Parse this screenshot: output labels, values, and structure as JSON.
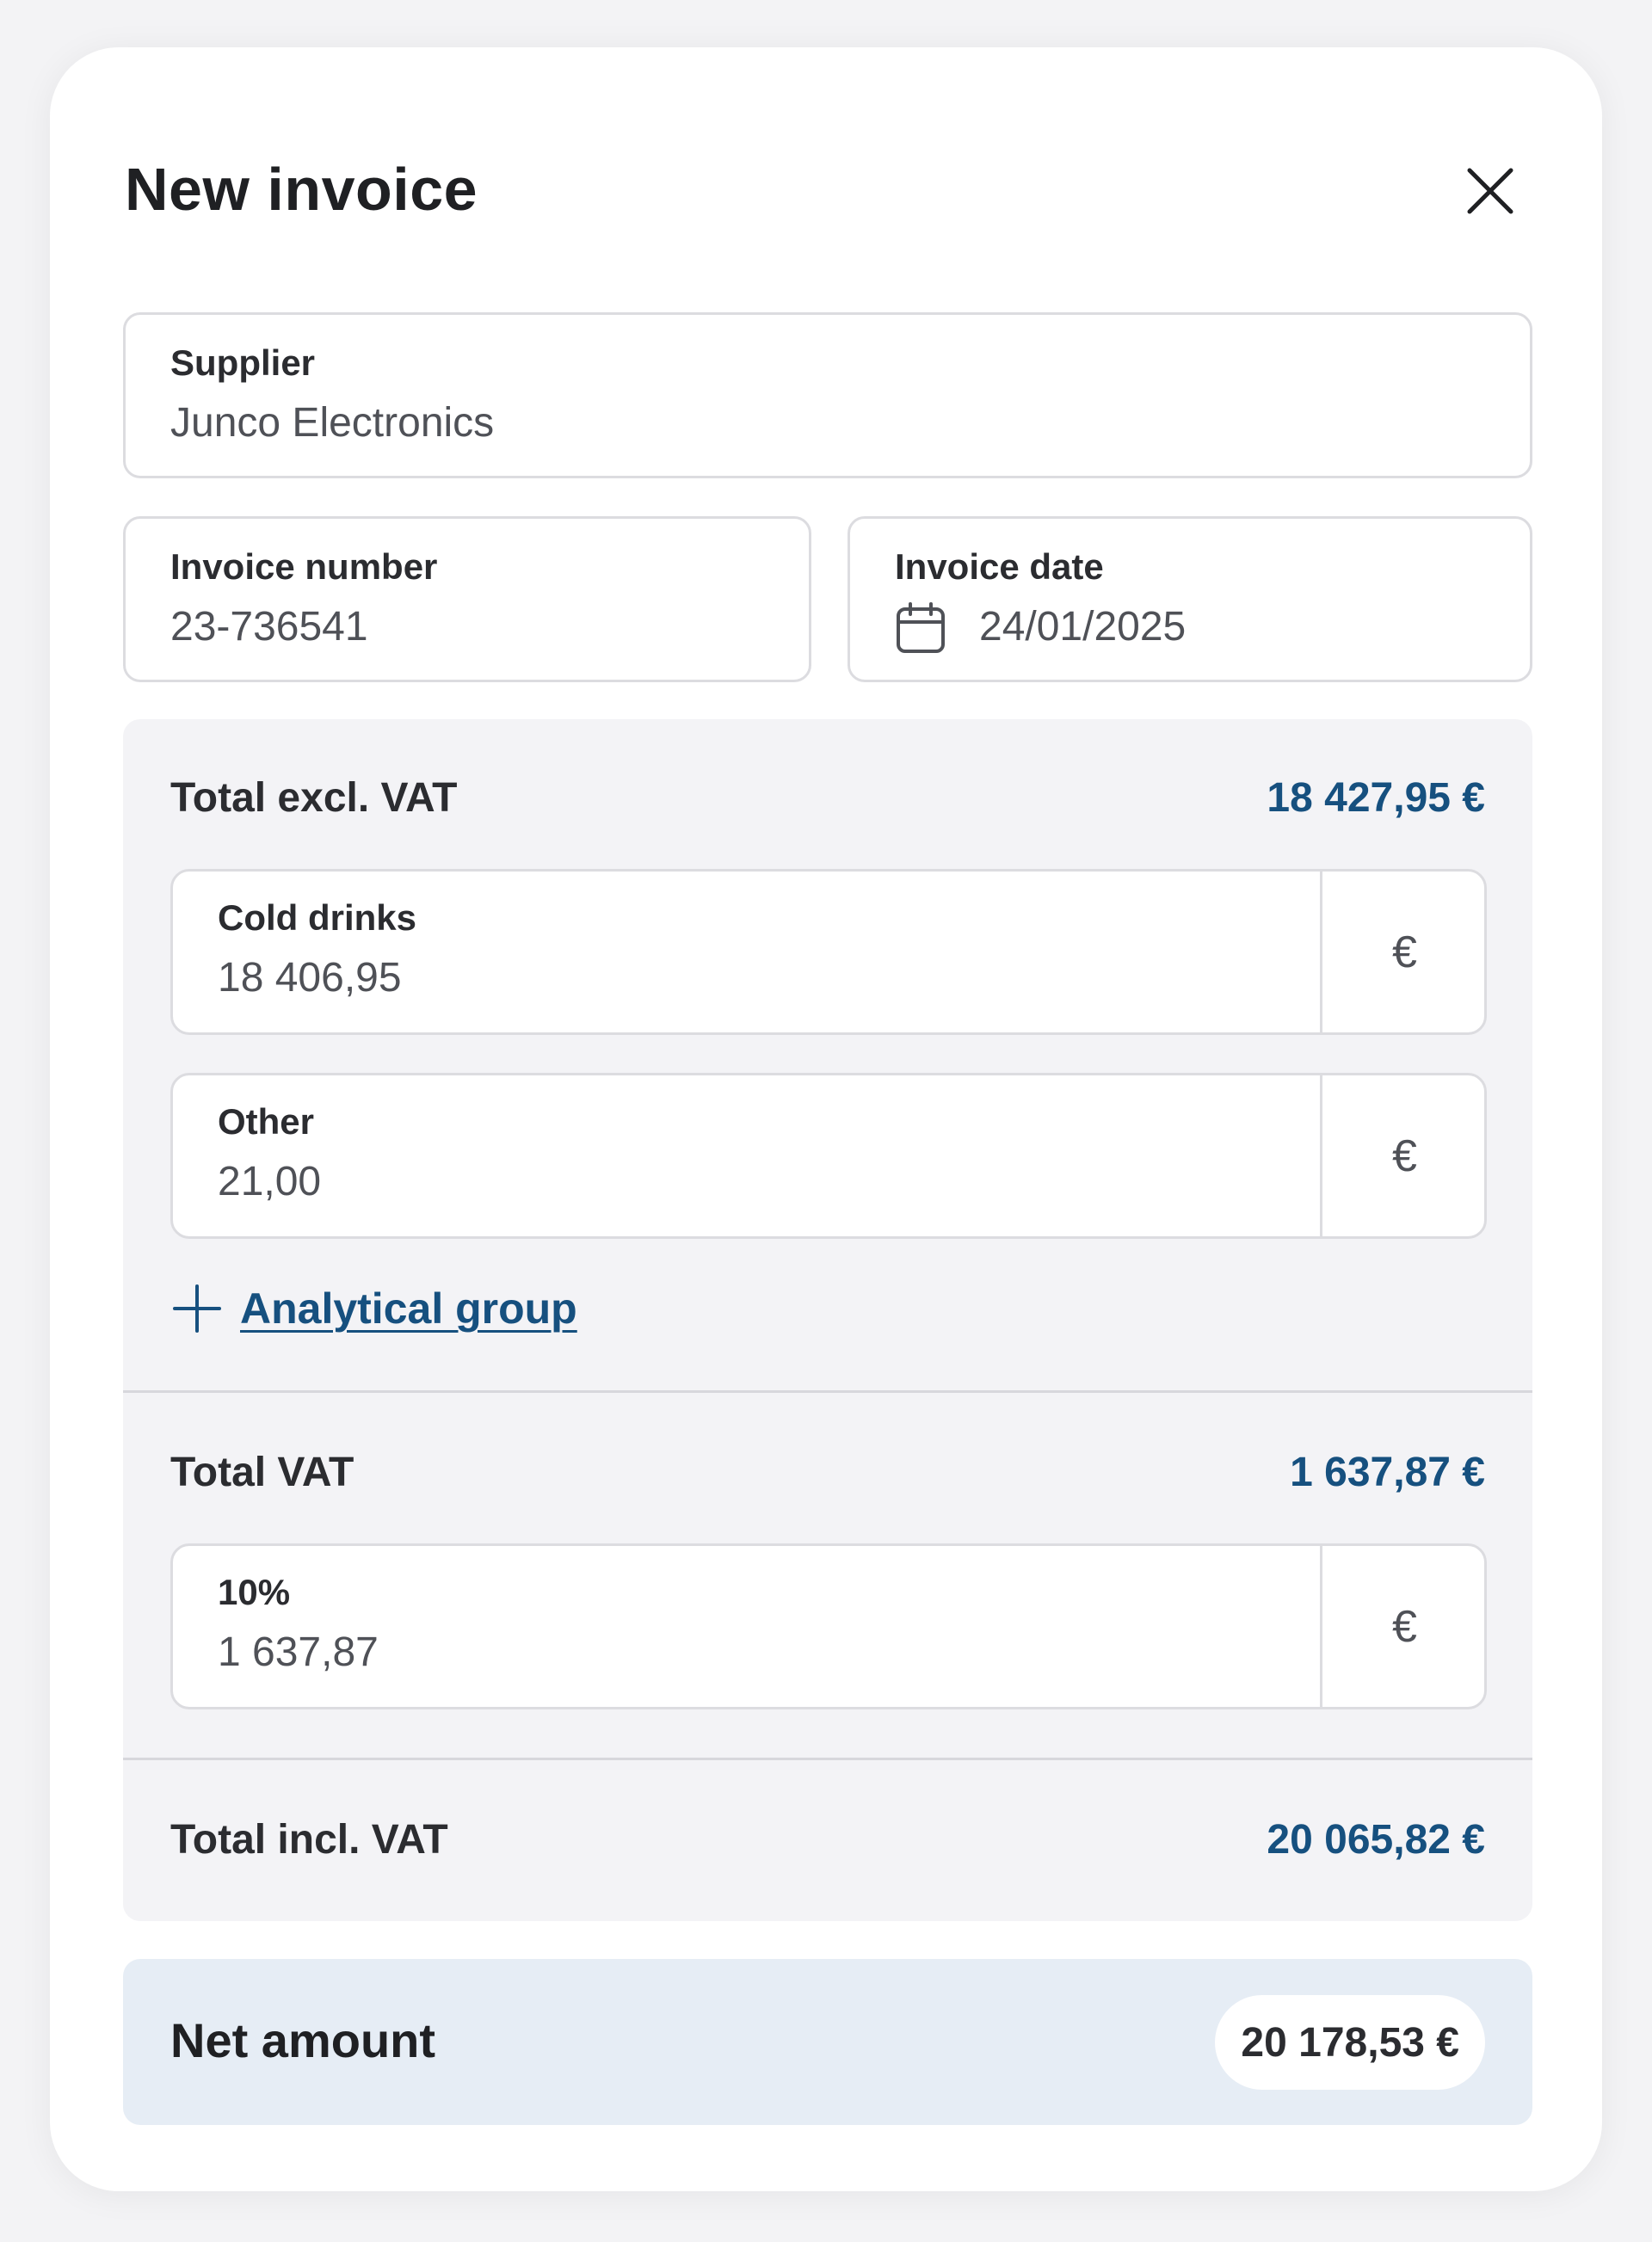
{
  "modal": {
    "title": "New invoice"
  },
  "supplier": {
    "label": "Supplier",
    "value": "Junco Electronics"
  },
  "invoice_number": {
    "label": "Invoice number",
    "value": "23-736541"
  },
  "invoice_date": {
    "label": "Invoice date",
    "value": "24/01/2025",
    "icon": "calendar-icon"
  },
  "excl_vat": {
    "label": "Total excl. VAT",
    "total": "18 427,95 €",
    "lines": [
      {
        "label": "Cold drinks",
        "value": "18 406,95",
        "currency": "€"
      },
      {
        "label": "Other",
        "value": "21,00",
        "currency": "€"
      }
    ],
    "add_label": "Analytical group"
  },
  "vat": {
    "label": "Total VAT",
    "total": "1 637,87 €",
    "lines": [
      {
        "label": "10%",
        "value": "1 637,87",
        "currency": "€"
      }
    ]
  },
  "incl_vat": {
    "label": "Total incl. VAT",
    "total": "20 065,82 €"
  },
  "net": {
    "label": "Net amount",
    "value": "20 178,53 €"
  },
  "colors": {
    "accent": "#16507f",
    "panel_bg": "#f3f3f6",
    "net_bg": "#e6edf5",
    "border": "#dcdce0"
  }
}
